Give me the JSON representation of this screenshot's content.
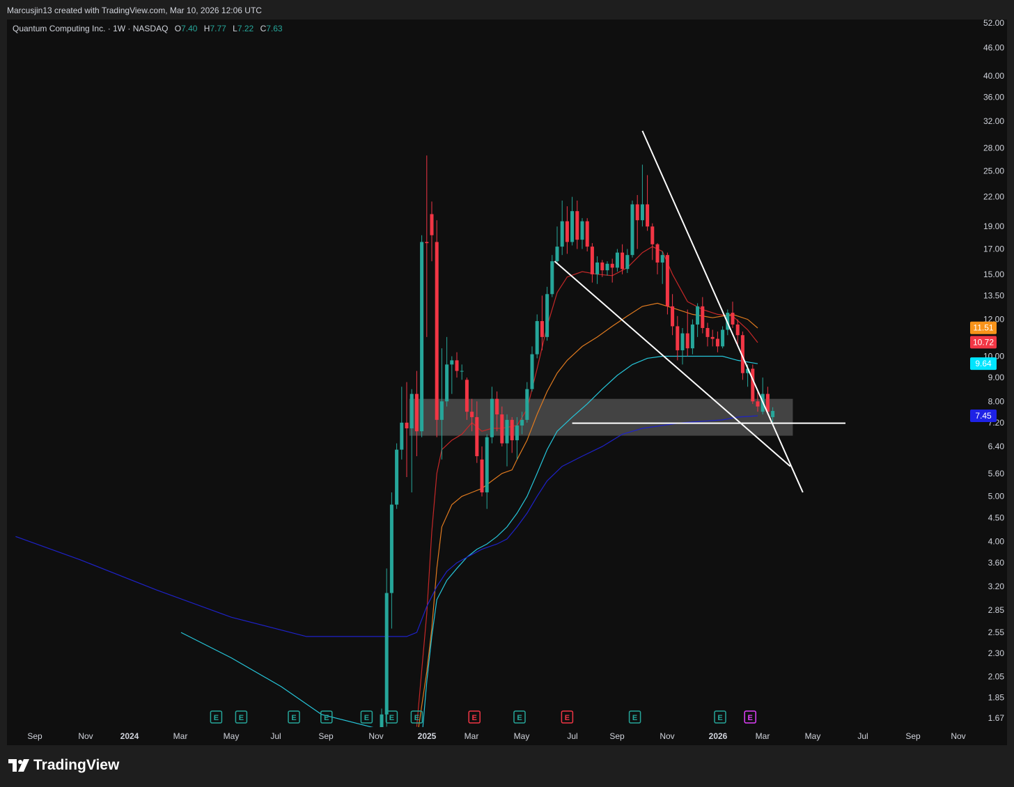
{
  "header": {
    "attribution": "Marcusjin13 created with TradingView.com, Mar 10, 2026 12:06 UTC"
  },
  "legend": {
    "title": "Quantum Computing Inc. · 1W · NASDAQ",
    "o_label": "O",
    "o_value": "7.40",
    "h_label": "H",
    "h_value": "7.77",
    "l_label": "L",
    "l_value": "7.22",
    "c_label": "C",
    "c_value": "7.63"
  },
  "brand": {
    "name": "TradingView"
  },
  "chart_data": {
    "type": "candlestick",
    "title": "Quantum Computing Inc. · 1W · NASDAQ",
    "interval": "1W",
    "y_scale": "log",
    "ylim": [
      1.6,
      54
    ],
    "y_ticks": [
      "52.00",
      "46.00",
      "40.00",
      "36.00",
      "32.00",
      "28.00",
      "25.00",
      "22.00",
      "19.00",
      "17.00",
      "15.00",
      "13.50",
      "12.00",
      "10.00",
      "9.00",
      "8.00",
      "7.20",
      "6.40",
      "5.60",
      "5.00",
      "4.50",
      "4.00",
      "3.60",
      "3.20",
      "2.85",
      "2.55",
      "2.30",
      "2.05",
      "1.85",
      "1.67"
    ],
    "x_ticks": [
      "Sep",
      "Nov",
      "2024",
      "Mar",
      "May",
      "Jul",
      "Sep",
      "Nov",
      "2025",
      "Mar",
      "May",
      "Jul",
      "Sep",
      "Nov",
      "2026",
      "Mar",
      "May",
      "Jul",
      "Sep",
      "Nov"
    ],
    "price_labels": [
      {
        "value": "11.51",
        "color": "#f7931a"
      },
      {
        "value": "10.72",
        "color": "#f23645"
      },
      {
        "value": "9.64",
        "color": "#00e5ff"
      },
      {
        "value": "7.45",
        "color": "#1e22e6"
      }
    ],
    "candles": [
      {
        "o": 1.3,
        "h": 1.75,
        "l": 1.2,
        "c": 1.7
      },
      {
        "o": 1.7,
        "h": 3.5,
        "l": 1.6,
        "c": 3.1
      },
      {
        "o": 3.1,
        "h": 5.1,
        "l": 2.6,
        "c": 4.8
      },
      {
        "o": 4.8,
        "h": 6.5,
        "l": 4.7,
        "c": 6.3
      },
      {
        "o": 6.3,
        "h": 8.6,
        "l": 6.0,
        "c": 7.2
      },
      {
        "o": 7.2,
        "h": 8.8,
        "l": 5.5,
        "c": 7.0
      },
      {
        "o": 7.0,
        "h": 8.5,
        "l": 5.1,
        "c": 8.3
      },
      {
        "o": 8.3,
        "h": 9.3,
        "l": 6.1,
        "c": 6.9
      },
      {
        "o": 6.9,
        "h": 18.2,
        "l": 6.7,
        "c": 17.6
      },
      {
        "o": 17.6,
        "h": 27.0,
        "l": 11.0,
        "c": 17.5
      },
      {
        "o": 20.2,
        "h": 21.5,
        "l": 16.0,
        "c": 18.2
      },
      {
        "o": 17.6,
        "h": 19.6,
        "l": 6.7,
        "c": 7.3
      },
      {
        "o": 7.3,
        "h": 10.4,
        "l": 6.0,
        "c": 8.0
      },
      {
        "o": 8.0,
        "h": 11.0,
        "l": 7.8,
        "c": 9.6
      },
      {
        "o": 9.6,
        "h": 10.0,
        "l": 8.3,
        "c": 9.8
      },
      {
        "o": 9.8,
        "h": 10.2,
        "l": 9.0,
        "c": 9.3
      },
      {
        "o": 9.3,
        "h": 9.6,
        "l": 8.9,
        "c": 9.3
      },
      {
        "o": 8.9,
        "h": 9.0,
        "l": 7.3,
        "c": 7.6
      },
      {
        "o": 7.6,
        "h": 8.1,
        "l": 6.9,
        "c": 7.4
      },
      {
        "o": 7.4,
        "h": 8.0,
        "l": 5.9,
        "c": 6.1
      },
      {
        "o": 6.0,
        "h": 6.4,
        "l": 5.0,
        "c": 5.1
      },
      {
        "o": 5.1,
        "h": 6.8,
        "l": 4.7,
        "c": 6.7
      },
      {
        "o": 6.7,
        "h": 8.6,
        "l": 6.5,
        "c": 8.1
      },
      {
        "o": 8.1,
        "h": 8.4,
        "l": 6.9,
        "c": 7.5
      },
      {
        "o": 7.5,
        "h": 7.8,
        "l": 6.4,
        "c": 6.5
      },
      {
        "o": 6.5,
        "h": 7.5,
        "l": 5.8,
        "c": 7.3
      },
      {
        "o": 7.3,
        "h": 7.4,
        "l": 6.2,
        "c": 6.6
      },
      {
        "o": 6.6,
        "h": 7.4,
        "l": 6.0,
        "c": 7.1
      },
      {
        "o": 7.1,
        "h": 7.6,
        "l": 6.8,
        "c": 7.3
      },
      {
        "o": 7.3,
        "h": 8.8,
        "l": 7.2,
        "c": 8.5
      },
      {
        "o": 8.5,
        "h": 10.5,
        "l": 8.4,
        "c": 10.1
      },
      {
        "o": 10.1,
        "h": 12.3,
        "l": 9.9,
        "c": 11.9
      },
      {
        "o": 11.9,
        "h": 13.5,
        "l": 10.3,
        "c": 11.0
      },
      {
        "o": 11.0,
        "h": 14.1,
        "l": 10.8,
        "c": 13.6
      },
      {
        "o": 13.6,
        "h": 16.5,
        "l": 13.4,
        "c": 16.0
      },
      {
        "o": 16.0,
        "h": 19.0,
        "l": 15.8,
        "c": 17.2
      },
      {
        "o": 17.2,
        "h": 21.6,
        "l": 16.5,
        "c": 19.5
      },
      {
        "o": 19.5,
        "h": 21.0,
        "l": 16.6,
        "c": 17.6
      },
      {
        "o": 17.6,
        "h": 22.0,
        "l": 17.3,
        "c": 20.5
      },
      {
        "o": 20.5,
        "h": 21.6,
        "l": 17.0,
        "c": 17.8
      },
      {
        "o": 17.8,
        "h": 19.8,
        "l": 17.0,
        "c": 19.5
      },
      {
        "o": 19.5,
        "h": 19.8,
        "l": 16.8,
        "c": 17.2
      },
      {
        "o": 17.2,
        "h": 17.5,
        "l": 14.4,
        "c": 15.0
      },
      {
        "o": 15.0,
        "h": 16.4,
        "l": 14.3,
        "c": 15.9
      },
      {
        "o": 15.9,
        "h": 16.1,
        "l": 14.8,
        "c": 15.3
      },
      {
        "o": 15.3,
        "h": 16.0,
        "l": 14.9,
        "c": 15.8
      },
      {
        "o": 15.8,
        "h": 16.2,
        "l": 14.4,
        "c": 15.5
      },
      {
        "o": 15.5,
        "h": 17.0,
        "l": 15.2,
        "c": 16.7
      },
      {
        "o": 16.7,
        "h": 17.4,
        "l": 15.0,
        "c": 15.4
      },
      {
        "o": 15.4,
        "h": 17.0,
        "l": 15.1,
        "c": 16.5
      },
      {
        "o": 16.5,
        "h": 21.6,
        "l": 16.3,
        "c": 21.2
      },
      {
        "o": 21.2,
        "h": 22.2,
        "l": 17.0,
        "c": 19.6
      },
      {
        "o": 19.6,
        "h": 25.8,
        "l": 19.0,
        "c": 21.2
      },
      {
        "o": 21.2,
        "h": 24.5,
        "l": 18.6,
        "c": 19.0
      },
      {
        "o": 19.0,
        "h": 19.3,
        "l": 16.1,
        "c": 17.4
      },
      {
        "o": 17.4,
        "h": 17.5,
        "l": 15.0,
        "c": 15.9
      },
      {
        "o": 15.9,
        "h": 16.8,
        "l": 14.3,
        "c": 16.5
      },
      {
        "o": 16.5,
        "h": 16.7,
        "l": 12.3,
        "c": 12.8
      },
      {
        "o": 12.8,
        "h": 13.6,
        "l": 11.1,
        "c": 11.6
      },
      {
        "o": 11.6,
        "h": 12.2,
        "l": 9.8,
        "c": 10.3
      },
      {
        "o": 10.3,
        "h": 11.5,
        "l": 9.6,
        "c": 11.2
      },
      {
        "o": 11.2,
        "h": 12.6,
        "l": 10.0,
        "c": 10.4
      },
      {
        "o": 10.4,
        "h": 12.0,
        "l": 10.1,
        "c": 11.7
      },
      {
        "o": 11.7,
        "h": 13.0,
        "l": 11.0,
        "c": 12.8
      },
      {
        "o": 12.8,
        "h": 13.4,
        "l": 11.2,
        "c": 11.5
      },
      {
        "o": 11.5,
        "h": 11.8,
        "l": 10.5,
        "c": 11.0
      },
      {
        "o": 11.0,
        "h": 11.4,
        "l": 10.5,
        "c": 10.9
      },
      {
        "o": 10.9,
        "h": 11.3,
        "l": 10.2,
        "c": 10.5
      },
      {
        "o": 10.5,
        "h": 11.6,
        "l": 10.4,
        "c": 11.4
      },
      {
        "o": 11.4,
        "h": 12.6,
        "l": 11.1,
        "c": 12.4
      },
      {
        "o": 12.4,
        "h": 13.1,
        "l": 11.5,
        "c": 11.7
      },
      {
        "o": 11.7,
        "h": 12.0,
        "l": 10.6,
        "c": 11.1
      },
      {
        "o": 11.1,
        "h": 11.3,
        "l": 8.9,
        "c": 9.2
      },
      {
        "o": 9.2,
        "h": 9.6,
        "l": 8.6,
        "c": 9.4
      },
      {
        "o": 9.4,
        "h": 9.6,
        "l": 7.9,
        "c": 8.0
      },
      {
        "o": 8.0,
        "h": 8.4,
        "l": 7.6,
        "c": 7.8
      },
      {
        "o": 7.6,
        "h": 9.0,
        "l": 7.5,
        "c": 8.3
      },
      {
        "o": 8.3,
        "h": 8.6,
        "l": 7.5,
        "c": 7.6
      },
      {
        "o": 7.4,
        "h": 7.77,
        "l": 7.22,
        "c": 7.63
      }
    ],
    "moving_averages": [
      {
        "color": "#c62828",
        "values": [
          [
            7,
            1.6
          ],
          [
            9,
            2.8
          ],
          [
            10,
            4.2
          ],
          [
            11,
            5.6
          ],
          [
            12,
            6.3
          ],
          [
            14,
            6.6
          ],
          [
            16,
            6.8
          ],
          [
            18,
            7.2
          ],
          [
            20,
            6.9
          ],
          [
            22,
            7.0
          ],
          [
            24,
            7.0
          ],
          [
            27,
            7.1
          ],
          [
            29,
            7.7
          ],
          [
            31,
            9.4
          ],
          [
            33,
            11.6
          ],
          [
            35,
            13.7
          ],
          [
            37,
            14.8
          ],
          [
            40,
            15.2
          ],
          [
            43,
            15.0
          ],
          [
            46,
            14.9
          ],
          [
            49,
            15.5
          ],
          [
            52,
            16.7
          ],
          [
            54,
            17.2
          ],
          [
            56,
            16.8
          ],
          [
            58,
            15.0
          ],
          [
            61,
            13.1
          ],
          [
            64,
            12.6
          ],
          [
            67,
            12.3
          ],
          [
            70,
            12.2
          ],
          [
            73,
            11.4
          ],
          [
            75,
            10.7
          ]
        ]
      },
      {
        "color": "#e07a1f",
        "values": [
          [
            7,
            1.5
          ],
          [
            9,
            2.1
          ],
          [
            10,
            2.6
          ],
          [
            11,
            3.5
          ],
          [
            12,
            4.3
          ],
          [
            14,
            4.8
          ],
          [
            16,
            5.0
          ],
          [
            18,
            5.1
          ],
          [
            20,
            5.2
          ],
          [
            22,
            5.4
          ],
          [
            24,
            5.6
          ],
          [
            26,
            5.7
          ],
          [
            27,
            6.0
          ],
          [
            29,
            6.6
          ],
          [
            31,
            7.5
          ],
          [
            33,
            8.4
          ],
          [
            35,
            9.2
          ],
          [
            37,
            9.8
          ],
          [
            40,
            10.5
          ],
          [
            43,
            11.0
          ],
          [
            46,
            11.6
          ],
          [
            49,
            12.2
          ],
          [
            52,
            12.8
          ],
          [
            55,
            13.0
          ],
          [
            58,
            12.7
          ],
          [
            62,
            12.3
          ],
          [
            66,
            12.1
          ],
          [
            70,
            12.3
          ],
          [
            73,
            12.0
          ],
          [
            75,
            11.5
          ]
        ]
      },
      {
        "color": "#26c6da",
        "values": [
          [
            -40,
            2.55
          ],
          [
            -30,
            2.25
          ],
          [
            -20,
            1.95
          ],
          [
            -12,
            1.7
          ],
          [
            8,
            1.5
          ],
          [
            9,
            2.0
          ],
          [
            10,
            2.5
          ],
          [
            11,
            3.0
          ],
          [
            13,
            3.3
          ],
          [
            15,
            3.5
          ],
          [
            17,
            3.7
          ],
          [
            19,
            3.85
          ],
          [
            21,
            3.95
          ],
          [
            23,
            4.1
          ],
          [
            25,
            4.3
          ],
          [
            27,
            4.6
          ],
          [
            29,
            5.0
          ],
          [
            31,
            5.6
          ],
          [
            33,
            6.3
          ],
          [
            35,
            6.9
          ],
          [
            38,
            7.4
          ],
          [
            41,
            7.9
          ],
          [
            44,
            8.5
          ],
          [
            47,
            9.1
          ],
          [
            50,
            9.6
          ],
          [
            53,
            9.9
          ],
          [
            56,
            10.0
          ],
          [
            60,
            10.0
          ],
          [
            64,
            10.0
          ],
          [
            68,
            10.0
          ],
          [
            71,
            9.8
          ],
          [
            75,
            9.64
          ]
        ]
      },
      {
        "color": "#1e22c8",
        "values": [
          [
            -73,
            4.1
          ],
          [
            -60,
            3.65
          ],
          [
            -45,
            3.15
          ],
          [
            -30,
            2.75
          ],
          [
            -15,
            2.5
          ],
          [
            5,
            2.5
          ],
          [
            7,
            2.55
          ],
          [
            9,
            2.9
          ],
          [
            11,
            3.2
          ],
          [
            13,
            3.45
          ],
          [
            15,
            3.6
          ],
          [
            17,
            3.7
          ],
          [
            20,
            3.85
          ],
          [
            23,
            3.95
          ],
          [
            25,
            4.05
          ],
          [
            27,
            4.3
          ],
          [
            29,
            4.6
          ],
          [
            31,
            5.0
          ],
          [
            33,
            5.4
          ],
          [
            36,
            5.8
          ],
          [
            40,
            6.1
          ],
          [
            44,
            6.4
          ],
          [
            48,
            6.8
          ],
          [
            52,
            7.0
          ],
          [
            56,
            7.1
          ],
          [
            60,
            7.2
          ],
          [
            64,
            7.25
          ],
          [
            68,
            7.3
          ],
          [
            71,
            7.4
          ],
          [
            75,
            7.45
          ]
        ]
      }
    ],
    "zone": {
      "low": 6.75,
      "high": 8.1
    },
    "trendlines": [
      {
        "from": {
          "i": 52,
          "p": 30.5
        },
        "to": {
          "i": 84,
          "p": 5.1
        }
      },
      {
        "from": {
          "i": 34.5,
          "p": 16.0
        },
        "to": {
          "i": 81.5,
          "p": 5.8
        }
      },
      {
        "from": {
          "i": 38,
          "p": 7.18
        },
        "to": {
          "i": 92.5,
          "p": 7.18
        }
      }
    ],
    "earnings_markers": [
      {
        "i": -33,
        "color": "#26a69a",
        "label": "E"
      },
      {
        "i": -28,
        "color": "#26a69a",
        "label": "E"
      },
      {
        "i": -17.5,
        "color": "#26a69a",
        "label": "E"
      },
      {
        "i": -11,
        "color": "#26a69a",
        "label": "E"
      },
      {
        "i": -3,
        "color": "#26a69a",
        "label": "E"
      },
      {
        "i": 2,
        "color": "#26a69a",
        "label": "E"
      },
      {
        "i": 7,
        "color": "#26a69a",
        "label": "E"
      },
      {
        "i": 18.5,
        "color": "#f23645",
        "label": "E"
      },
      {
        "i": 27.5,
        "color": "#26a69a",
        "label": "E"
      },
      {
        "i": 37,
        "color": "#f23645",
        "label": "E"
      },
      {
        "i": 50.5,
        "color": "#26a69a",
        "label": "E"
      },
      {
        "i": 67.5,
        "color": "#26a69a",
        "label": "E"
      },
      {
        "i": 73.5,
        "color": "#e040fb",
        "label": "E"
      }
    ]
  }
}
